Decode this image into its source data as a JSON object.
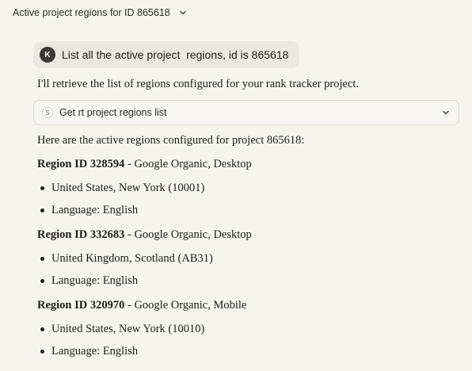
{
  "header": {
    "title": "Active project regions for ID 865618",
    "chevron_icon": "chevron-down-icon"
  },
  "user_message": {
    "avatar_initial": "K",
    "text": "List all the active project  regions, id is 865618"
  },
  "assistant": {
    "intro": "I'll retrieve the list of regions configured for your rank tracker project.",
    "tool_call": {
      "icon_letter": "S",
      "label": "Get rt project regions list",
      "chevron_icon": "chevron-down-icon"
    },
    "summary": "Here are the active regions configured for project 865618:",
    "regions": [
      {
        "id_label": "Region ID 328594",
        "engine": " - Google Organic, Desktop",
        "location": "United States, New York (10001)",
        "language": "Language: English"
      },
      {
        "id_label": "Region ID 332683",
        "engine": " - Google Organic, Desktop",
        "location": "United Kingdom, Scotland (AB31)",
        "language": "Language: English"
      },
      {
        "id_label": "Region ID 320970",
        "engine": " - Google Organic, Mobile",
        "location": "United States, New York (10010)",
        "language": "Language: English"
      }
    ]
  }
}
